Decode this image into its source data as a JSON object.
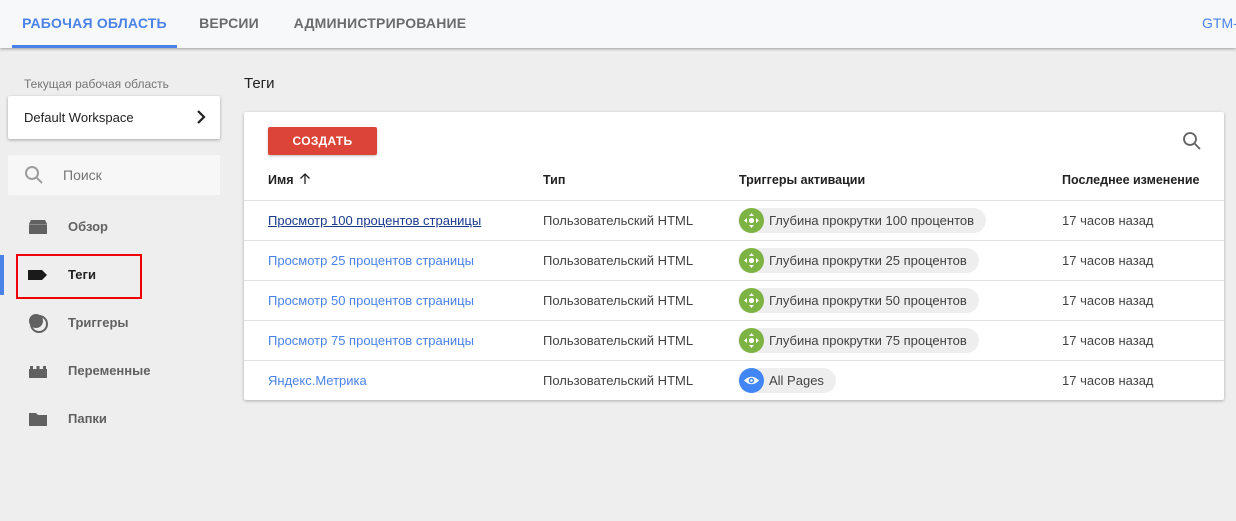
{
  "topbar": {
    "tabs": [
      {
        "label": "РАБОЧАЯ ОБЛАСТЬ",
        "active": true
      },
      {
        "label": "ВЕРСИИ",
        "active": false
      },
      {
        "label": "АДМИНИСТРИРОВАНИЕ",
        "active": false
      }
    ],
    "container_id": "GTM-"
  },
  "sidebar": {
    "workspace_label": "Текущая рабочая область",
    "workspace_name": "Default Workspace",
    "search_placeholder": "Поиск",
    "items": [
      {
        "label": "Обзор",
        "icon": "overview-icon",
        "active": false
      },
      {
        "label": "Теги",
        "icon": "tag-icon",
        "active": true
      },
      {
        "label": "Триггеры",
        "icon": "trigger-icon",
        "active": false
      },
      {
        "label": "Переменные",
        "icon": "variables-icon",
        "active": false
      },
      {
        "label": "Папки",
        "icon": "folder-icon",
        "active": false
      }
    ]
  },
  "main": {
    "title": "Теги",
    "create_label": "СОЗДАТЬ",
    "columns": {
      "name": "Имя",
      "type": "Тип",
      "triggers": "Триггеры активации",
      "modified": "Последнее изменение"
    },
    "sort": {
      "column": "name",
      "direction": "ascending"
    },
    "rows": [
      {
        "name": "Просмотр 100 процентов страницы",
        "type": "Пользовательский HTML",
        "trigger": "Глубина прокрутки 100 процентов",
        "trigger_icon": "scroll-depth-icon",
        "trigger_color": "#7cb342",
        "modified": "17 часов назад"
      },
      {
        "name": "Просмотр 25 процентов страницы",
        "type": "Пользовательский HTML",
        "trigger": "Глубина прокрутки 25 процентов",
        "trigger_icon": "scroll-depth-icon",
        "trigger_color": "#7cb342",
        "modified": "17 часов назад"
      },
      {
        "name": "Просмотр 50 процентов страницы",
        "type": "Пользовательский HTML",
        "trigger": "Глубина прокрутки 50 процентов",
        "trigger_icon": "scroll-depth-icon",
        "trigger_color": "#7cb342",
        "modified": "17 часов назад"
      },
      {
        "name": "Просмотр 75 процентов страницы",
        "type": "Пользовательский HTML",
        "trigger": "Глубина прокрутки 75 процентов",
        "trigger_icon": "scroll-depth-icon",
        "trigger_color": "#7cb342",
        "modified": "17 часов назад"
      },
      {
        "name": "Яндекс.Метрика",
        "type": "Пользовательский HTML",
        "trigger": "All Pages",
        "trigger_icon": "pageview-eye-icon",
        "trigger_color": "#4285f4",
        "modified": "17 часов назад"
      }
    ]
  },
  "colors": {
    "accent": "#4a82e8",
    "create_button": "#db4437",
    "highlight": "#ee0000"
  }
}
